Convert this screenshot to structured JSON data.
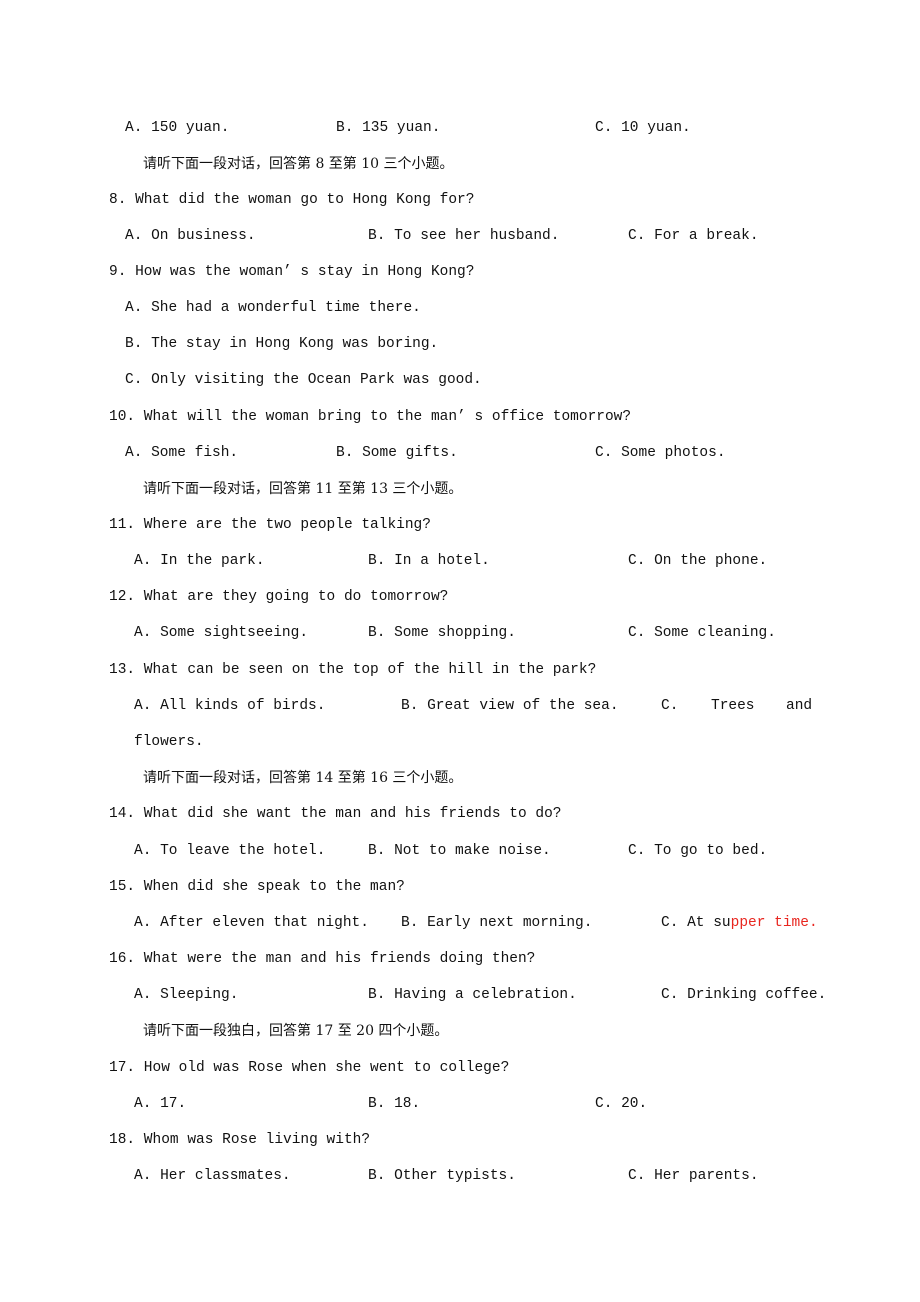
{
  "page": {
    "q7_options": {
      "a": "A. 150 yuan.",
      "b": "B. 135 yuan.",
      "c": "C. 10 yuan."
    },
    "instructions": {
      "i8_10": "请听下面一段对话，回答第 8 至第 10 三个小题。",
      "i11_13": "请听下面一段对话，回答第 11 至第 13 三个小题。",
      "i14_16": "请听下面一段对话，回答第 14 至第 16 三个小题。",
      "i17_20": "请听下面一段独白，回答第 17 至 20 四个小题。"
    },
    "questions": [
      {
        "q": "8. What did the woman go to Hong Kong for?",
        "a": "A. On business.",
        "b": "B. To see her husband.",
        "c": "C. For a break."
      },
      {
        "q": "9. How was the woman’ s stay in Hong Kong?",
        "a": "A. She had a wonderful time there.",
        "b": "B. The stay in Hong Kong was boring.",
        "c": "C. Only visiting the Ocean Park was good."
      },
      {
        "q": "10. What will the woman bring to the man’ s office tomorrow?",
        "a": "A. Some fish.",
        "b": "B. Some gifts.",
        "c": "C. Some photos."
      },
      {
        "q": "11. Where are the two people talking?",
        "a": "A. In the park.",
        "b": "B. In a hotel.",
        "c": "C. On the phone."
      },
      {
        "q": "12. What are they going to do tomorrow?",
        "a": "A. Some sightseeing.",
        "b": "B. Some shopping.",
        "c": "C. Some cleaning."
      },
      {
        "q": "13. What can be seen on the top of the hill in the park?",
        "a": "A. All kinds of birds.",
        "b": "B. Great view of the sea.",
        "c_label": "C.",
        "c_w1": "Trees",
        "c_w2": "and",
        "c_cont": "flowers."
      },
      {
        "q": "14. What did she want the man and his friends to do?",
        "a": "A. To leave the hotel.",
        "b": "B. Not to make noise.",
        "c": "C. To go to bed."
      },
      {
        "q": "15. When did she speak to the man?",
        "a": "A. After eleven that night.",
        "b": "B. Early next morning.",
        "c_black": "C. At su",
        "c_red": "pper time."
      },
      {
        "q": "16. What were the man and his friends doing then?",
        "a": "A. Sleeping.",
        "b": "B. Having a celebration.",
        "c": "C. Drinking coffee."
      },
      {
        "q": "17. How old was Rose when she went to college?",
        "a": "A. 17.",
        "b": "B. 18.",
        "c": "C. 20."
      },
      {
        "q": "18. Whom was Rose living with?",
        "a": "A. Her classmates.",
        "b": "B. Other typists.",
        "c": "C. Her parents."
      }
    ]
  }
}
